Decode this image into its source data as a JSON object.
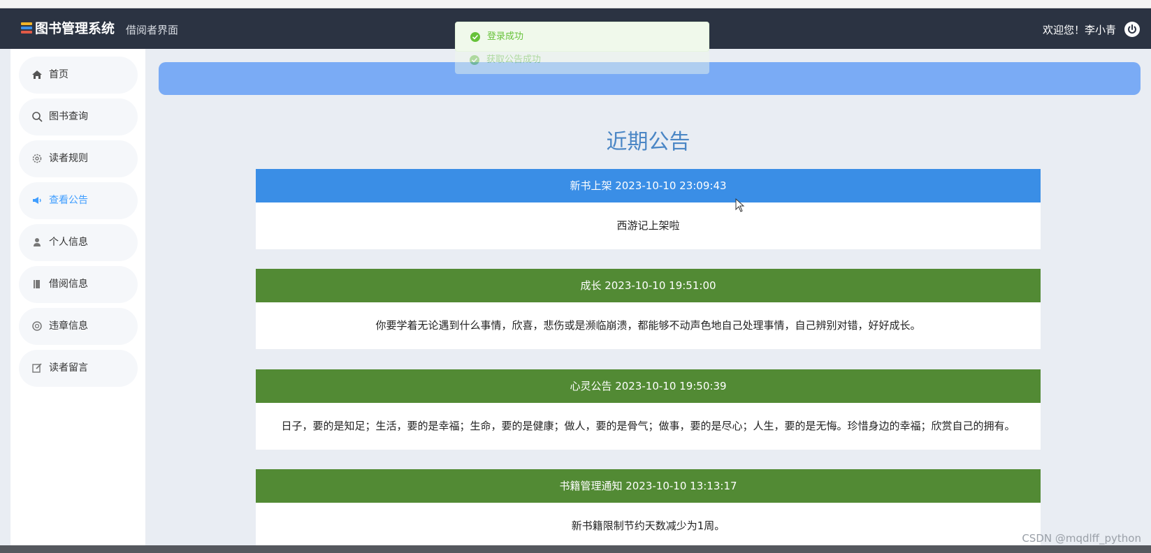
{
  "app": {
    "title": "图书管理系统",
    "subtitle": "借阅者界面",
    "welcome": "欢迎您！李小青"
  },
  "toasts": [
    {
      "text": "登录成功",
      "icon": "success-check-icon"
    },
    {
      "text": "获取公告成功",
      "icon": "success-check-icon"
    }
  ],
  "sidebar": {
    "items": [
      {
        "label": "首页",
        "icon": "home-icon",
        "active": false
      },
      {
        "label": "图书查询",
        "icon": "search-icon",
        "active": false
      },
      {
        "label": "读者规则",
        "icon": "gear-icon",
        "active": false
      },
      {
        "label": "查看公告",
        "icon": "speaker-icon",
        "active": true
      },
      {
        "label": "个人信息",
        "icon": "user-icon",
        "active": false
      },
      {
        "label": "借阅信息",
        "icon": "book-icon",
        "active": false
      },
      {
        "label": "违章信息",
        "icon": "warning-circle-icon",
        "active": false
      },
      {
        "label": "读者留言",
        "icon": "edit-icon",
        "active": false
      }
    ]
  },
  "main": {
    "title": "近期公告",
    "notices": [
      {
        "heading": "新书上架 2023-10-10 23:09:43",
        "body": "西游记上架啦",
        "color": "#3a8ee6"
      },
      {
        "heading": "成长 2023-10-10 19:51:00",
        "body": "你要学着无论遇到什么事情，欣喜，悲伤或是濒临崩溃，都能够不动声色地自己处理事情，自己辨别对错，好好成长。",
        "color": "#528a34"
      },
      {
        "heading": "心灵公告 2023-10-10 19:50:39",
        "body": "日子，要的是知足；生活，要的是幸福；生命，要的是健康；做人，要的是骨气；做事，要的是尽心；人生，要的是无悔。珍惜身边的幸福；欣赏自己的拥有。",
        "color": "#528a34"
      },
      {
        "heading": "书籍管理通知 2023-10-10 13:13:17",
        "body": "新书籍限制节约天数减少为1周。",
        "color": "#528a34"
      }
    ]
  },
  "colors": {
    "topbar": "#2b3342",
    "banner": "#7aabf5",
    "active": "#409eff",
    "success": "#67c23a"
  },
  "watermark": "CSDN @mqdlff_python"
}
